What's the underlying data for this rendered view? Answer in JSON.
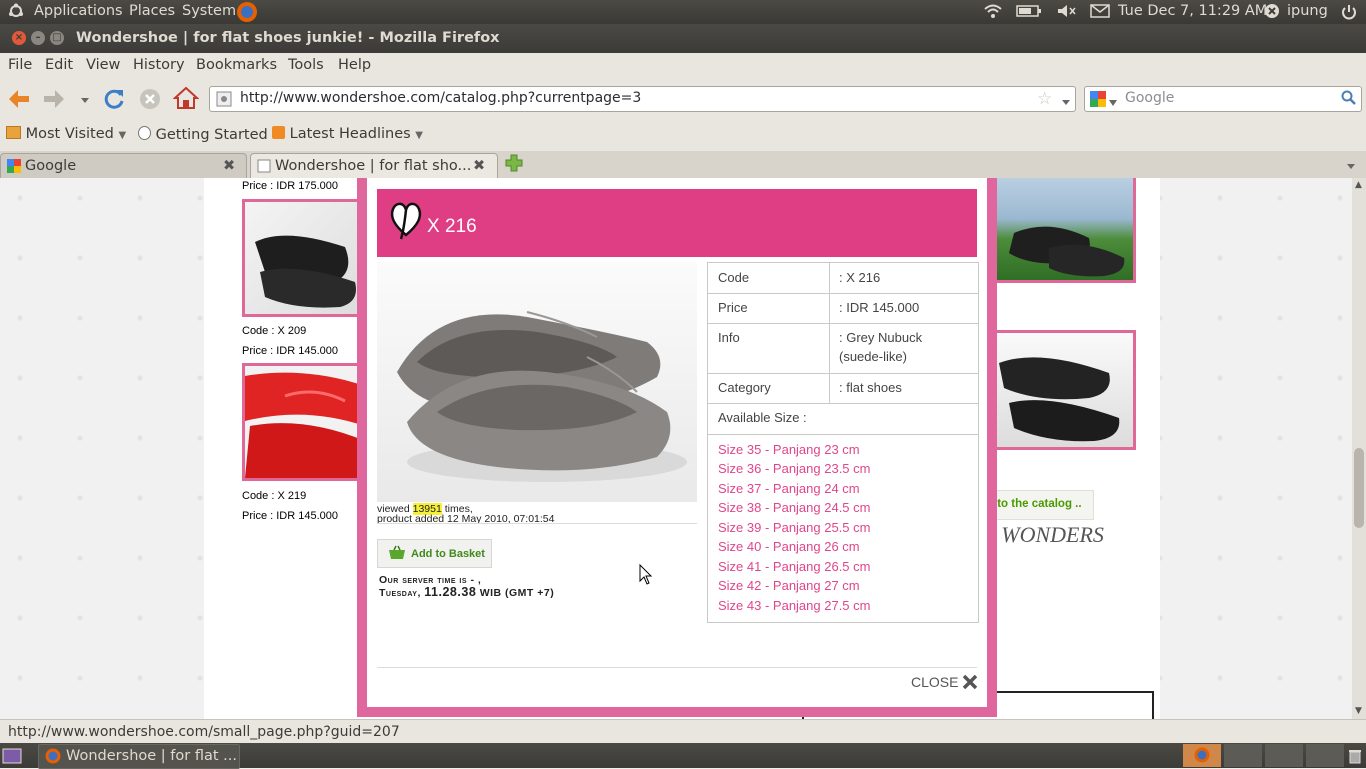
{
  "top_panel": {
    "applications": "Applications",
    "places": "Places",
    "system": "System",
    "clock": "Tue Dec  7, 11:29 AM",
    "user": "ipung"
  },
  "window": {
    "title": "Wondershoe | for flat shoes junkie! - Mozilla Firefox"
  },
  "menu": [
    "File",
    "Edit",
    "View",
    "History",
    "Bookmarks",
    "Tools",
    "Help"
  ],
  "toolbar": {
    "url": "http://www.wondershoe.com/catalog.php?currentpage=3",
    "search_placeholder": "Google"
  },
  "bookmarks": [
    "Most Visited",
    "Getting Started",
    "Latest Headlines"
  ],
  "tabs": [
    {
      "label": "Google"
    },
    {
      "label": "Wondershoe | for flat sho..."
    }
  ],
  "page": {
    "price_top": "Price : IDR 175.000",
    "item1_code": "Code : X 209",
    "item1_price": "Price : IDR 145.000",
    "item2_code": "Code : X 219",
    "item2_price": "Price : IDR 145.000",
    "back_to_catalog": "o to the catalog ..",
    "slogan": "e WONDERS"
  },
  "modal": {
    "title": "X 216",
    "viewed_prefix": "viewed",
    "viewed_count": "13951",
    "viewed_suffix": "times,",
    "added": "product added 12 May 2010, 07:01:54",
    "add_to_basket": "Add to Basket",
    "server_time_line1": "Our server time is - ,",
    "server_time_line2_a": "Tuesday,",
    "server_time_line2_b": "11.28.38",
    "server_time_line2_c": "WIB (GMT +7)",
    "close": "CLOSE",
    "info": {
      "code_label": "Code",
      "code_value": ": X 216",
      "price_label": "Price",
      "price_value": ": IDR 145.000",
      "info_label": "Info",
      "info_value_1": ": Grey Nubuck",
      "info_value_2": "(suede-like)",
      "category_label": "Category",
      "category_value": ": flat shoes",
      "available_label": "Available Size :"
    },
    "sizes": [
      "Size 35 - Panjang 23 cm",
      "Size 36 - Panjang 23.5 cm",
      "Size 37 - Panjang 24 cm",
      "Size 38 - Panjang 24.5 cm",
      "Size 39 - Panjang 25.5 cm",
      "Size 40 - Panjang 26 cm",
      "Size 41 - Panjang 26.5 cm",
      "Size 42 - Panjang 27 cm",
      "Size 43 - Panjang 27.5 cm"
    ]
  },
  "statusbar": {
    "link": "http://www.wondershoe.com/small_page.php?guid=207"
  },
  "taskbar": {
    "window": "Wondershoe | for flat ..."
  },
  "colors": {
    "accent_pink": "#df3e84",
    "size_link": "#e0468c",
    "panel": "#3c3b37"
  }
}
